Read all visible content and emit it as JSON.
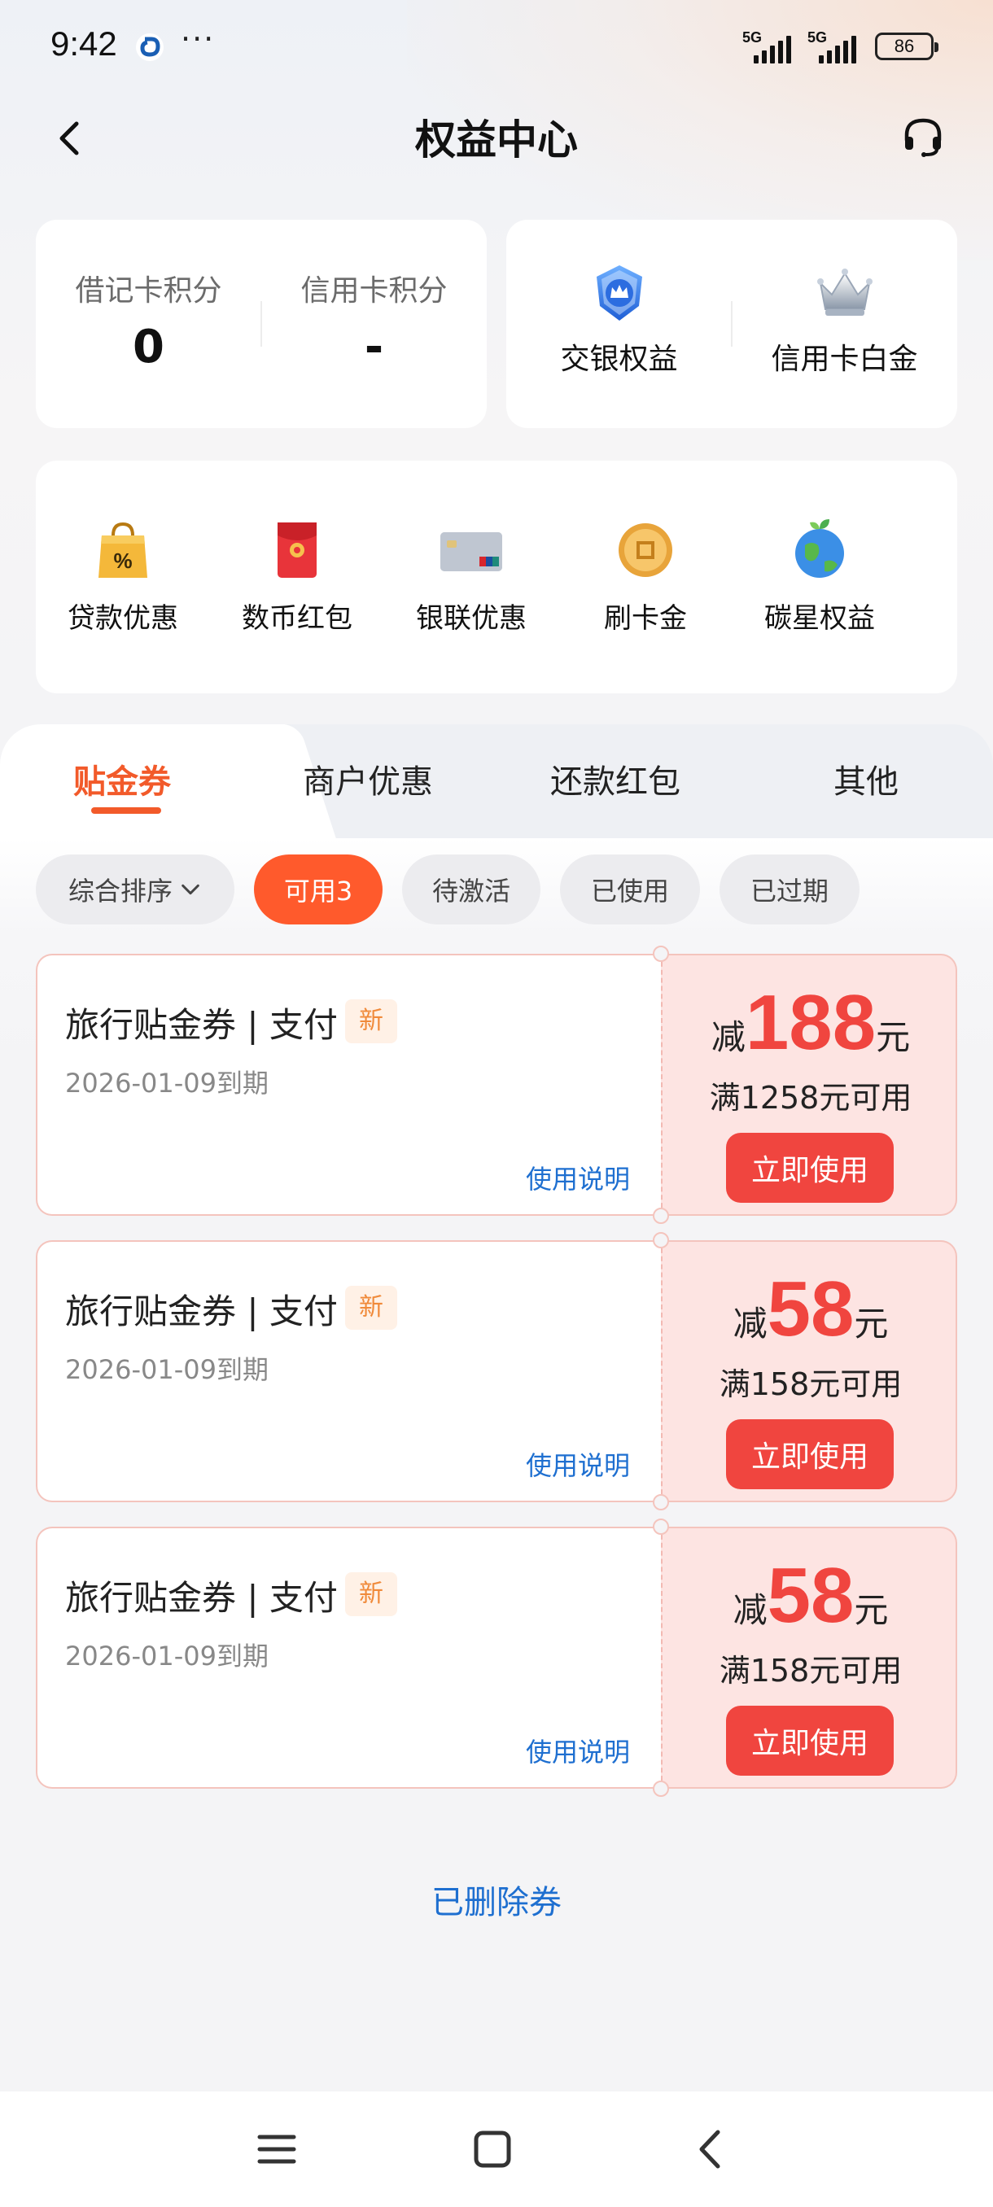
{
  "status": {
    "time": "9:42",
    "dots": "···",
    "network1": "5G",
    "network2": "5G",
    "battery": "86"
  },
  "header": {
    "title": "权益中心",
    "back_icon": "chevron-left-icon",
    "service_icon": "headset-icon"
  },
  "points": {
    "debit_label": "借记卡积分",
    "debit_value": "0",
    "credit_label": "信用卡积分",
    "credit_value": "-"
  },
  "rights": {
    "bocom_label": "交银权益",
    "bocom_icon": "blue-crown-badge-icon",
    "platinum_label": "信用卡白金",
    "platinum_icon": "silver-crown-icon"
  },
  "quick_items": [
    {
      "label": "贷款优惠",
      "icon": "shopping-bag-percent-icon"
    },
    {
      "label": "数币红包",
      "icon": "red-envelope-icon"
    },
    {
      "label": "银联优惠",
      "icon": "unionpay-card-icon"
    },
    {
      "label": "刷卡金",
      "icon": "gold-coin-icon"
    },
    {
      "label": "碳星权益",
      "icon": "earth-leaf-icon"
    }
  ],
  "tabs": [
    {
      "label": "贴金券",
      "active": true
    },
    {
      "label": "商户优惠",
      "active": false
    },
    {
      "label": "还款红包",
      "active": false
    },
    {
      "label": "其他",
      "active": false
    }
  ],
  "filters": {
    "sort": "综合排序",
    "available": "可用3",
    "pending": "待激活",
    "used": "已使用",
    "expired": "已过期"
  },
  "coupons": [
    {
      "title": "旅行贴金券 | 支付",
      "badge": "新",
      "expiry": "2026-01-09到期",
      "instructions": "使用说明",
      "prefix": "减",
      "amount": "188",
      "suffix": "元",
      "condition": "满1258元可用",
      "button": "立即使用"
    },
    {
      "title": "旅行贴金券 | 支付",
      "badge": "新",
      "expiry": "2026-01-09到期",
      "instructions": "使用说明",
      "prefix": "减",
      "amount": "58",
      "suffix": "元",
      "condition": "满158元可用",
      "button": "立即使用"
    },
    {
      "title": "旅行贴金券 | 支付",
      "badge": "新",
      "expiry": "2026-01-09到期",
      "instructions": "使用说明",
      "prefix": "减",
      "amount": "58",
      "suffix": "元",
      "condition": "满158元可用",
      "button": "立即使用"
    }
  ],
  "deleted_link": "已删除券",
  "colors": {
    "accent": "#f25a2a",
    "coupon_red": "#f0453f",
    "link_blue": "#1e6fd0"
  }
}
